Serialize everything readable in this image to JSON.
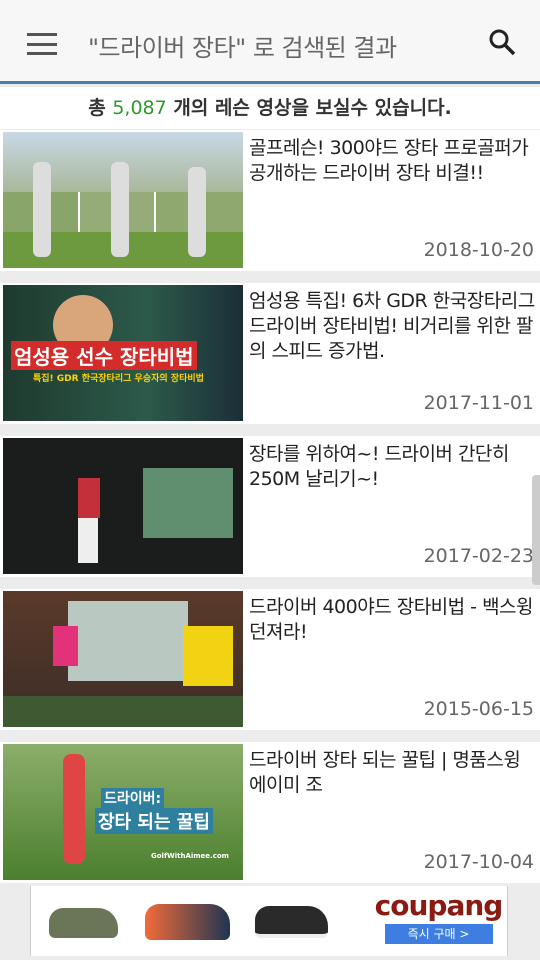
{
  "header": {
    "title": "\"드라이버 장타\" 로 검색된 결과",
    "menu_icon": "hamburger-icon",
    "search_icon": "search-icon"
  },
  "summary": {
    "prefix": "총 ",
    "count": "5,087",
    "suffix": " 개의 레슨 영상을 보실수 있습니다."
  },
  "colors": {
    "accent_line": "#4a7fa5",
    "count_green": "#2e9a2e",
    "buy_button": "#3d7ee0"
  },
  "videos": [
    {
      "title": "골프레슨! 300야드 장타 프로골퍼가 공개하는 드라이버 장타 비결!!",
      "date": "2018-10-20"
    },
    {
      "title": "엄성용 특집! 6차 GDR 한국장타리그 드라이버 장타비법! 비거리를 위한 팔의 스피드 증가법.",
      "date": "2017-11-01",
      "thumb_text": "엄성용 선수 장타비법",
      "thumb_sub": "특집! GDR 한국장타리그 우승자의 장타비법"
    },
    {
      "title": "장타를 위하여~! 드라이버 간단히 250M 날리기~!",
      "date": "2017-02-23"
    },
    {
      "title": "드라이버 400야드 장타비법 - 백스윙 던져라!",
      "date": "2015-06-15"
    },
    {
      "title": "드라이버 장타 되는 꿀팁 | 명품스윙 에이미 조",
      "date": "2017-10-04",
      "thumb_text": "드라이버:",
      "thumb_text2": "장타 되는 꿀팁",
      "thumb_sub": "GolfWithAimee.com"
    }
  ],
  "ad": {
    "brand": "coupang",
    "button": "즉시 구매 >"
  }
}
